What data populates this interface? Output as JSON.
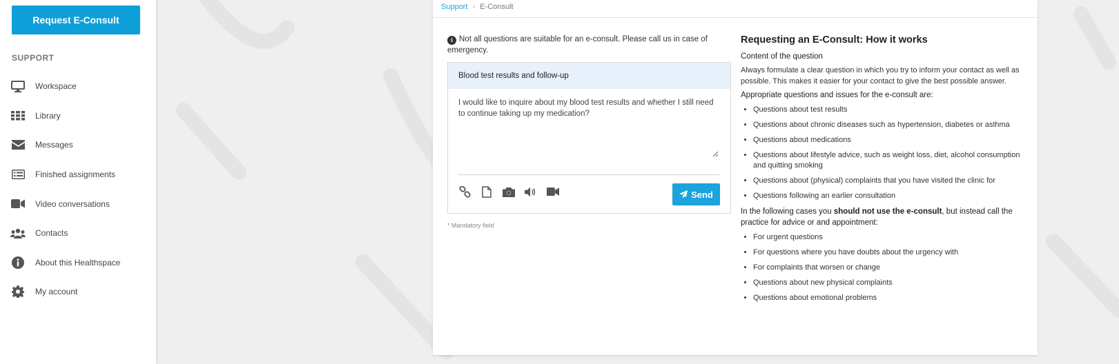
{
  "sidebar": {
    "request_button": "Request E-Consult",
    "section_title": "SUPPORT",
    "items": [
      {
        "label": "Workspace",
        "icon": "monitor-icon"
      },
      {
        "label": "Library",
        "icon": "grid-icon"
      },
      {
        "label": "Messages",
        "icon": "envelope-icon"
      },
      {
        "label": "Finished assignments",
        "icon": "checklist-icon"
      },
      {
        "label": "Video conversations",
        "icon": "video-camera-icon"
      },
      {
        "label": "Contacts",
        "icon": "users-icon"
      },
      {
        "label": "About this Healthspace",
        "icon": "info-icon"
      },
      {
        "label": "My account",
        "icon": "gear-icon"
      }
    ]
  },
  "breadcrumb": {
    "root": "Support",
    "current": "E-Consult"
  },
  "form": {
    "notice": "Not all questions are suitable for an e-consult. Please call us in case of emergency.",
    "subject_value": "Blood test results and follow-up",
    "message_value": "I would like to inquire about my blood test results and whether I still need to continue taking up my medication?",
    "send_label": "Send",
    "mandatory_note": "* Mandatory field"
  },
  "info": {
    "title": "Requesting an E-Consult: How it works",
    "content_heading": "Content of the question",
    "content_text": "Always formulate a clear question in which you try to inform your contact as well as possible. This makes it easier for your contact to give the best possible answer.",
    "appropriate_heading": "Appropriate questions and issues for the e-consult are:",
    "appropriate_items": [
      "Questions about test results",
      "Questions about chronic diseases such as hypertension, diabetes or asthma",
      "Questions about medications",
      "Questions about lifestyle advice, such as weight loss, diet, alcohol consumption and quitting smoking",
      "Questions about (physical) complaints that you have visited the clinic for",
      "Questions following an earlier consultation"
    ],
    "not_use_pre": "In the following cases you ",
    "not_use_bold": "should not use the e-consult",
    "not_use_post": ", but instead call the practice for advice or and appointment:",
    "not_use_items": [
      "For urgent questions",
      "For questions where you have doubts about the urgency with",
      "For complaints that worsen or change",
      "Questions about new physical complaints",
      "Questions about emotional problems"
    ]
  }
}
